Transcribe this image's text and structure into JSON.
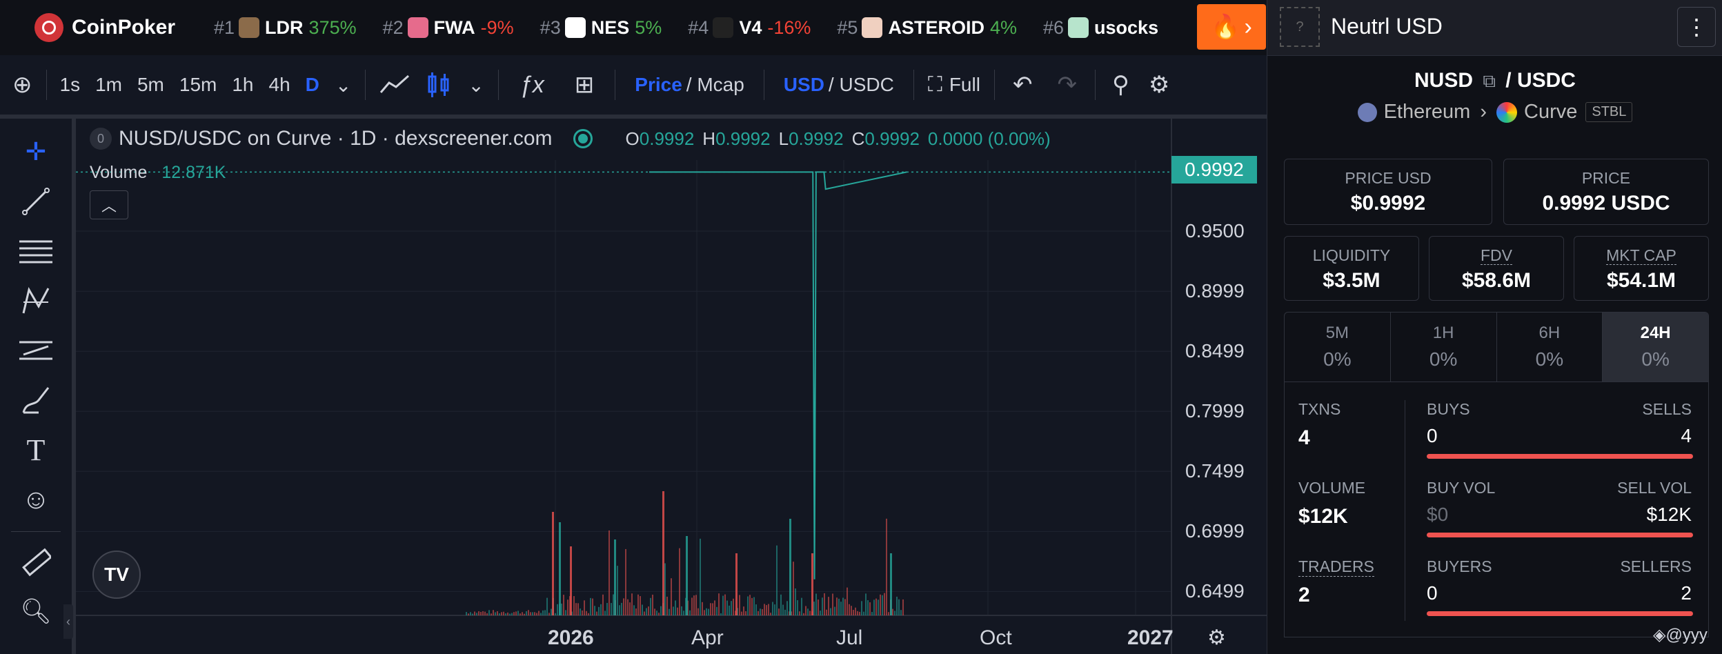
{
  "brand": {
    "name": "CoinPoker"
  },
  "tickers": [
    {
      "rank": "#1",
      "symbol": "LDR",
      "change": "375%",
      "dir": "pos",
      "color": "#8b6b4a"
    },
    {
      "rank": "#2",
      "symbol": "FWA",
      "change": "-9%",
      "dir": "neg",
      "color": "#e66b8c"
    },
    {
      "rank": "#3",
      "symbol": "NES",
      "change": "5%",
      "dir": "pos",
      "color": "#ffffff"
    },
    {
      "rank": "#4",
      "symbol": "V4",
      "change": "-16%",
      "dir": "neg",
      "color": "#222222"
    },
    {
      "rank": "#5",
      "symbol": "ASTEROID",
      "change": "4%",
      "dir": "pos",
      "color": "#f0d0c0"
    },
    {
      "rank": "#6",
      "symbol": "usocks",
      "change": "",
      "dir": "pos",
      "color": "#b7e4cc"
    }
  ],
  "toolbar": {
    "intervals": [
      "1s",
      "1m",
      "5m",
      "15m",
      "1h",
      "4h",
      "D"
    ],
    "price_label": "Price",
    "mcap_label": "/ Mcap",
    "usd_label": "USD",
    "usdc_label": "/ USDC",
    "full_label": "Full"
  },
  "chart_header": {
    "badge": "0",
    "title": "NUSD/USDC on Curve · 1D · dexscreener.com",
    "o_key": "O",
    "o_val": "0.9992",
    "h_key": "H",
    "h_val": "0.9992",
    "l_key": "L",
    "l_val": "0.9992",
    "c_key": "C",
    "c_val": "0.9992",
    "change": "0.0000 (0.00%)",
    "volume_label": "Volume",
    "volume_value": "12.871K"
  },
  "chart_data": {
    "type": "line",
    "pair": "NUSD/USDC",
    "last_price": "0.9992",
    "y_ticks": [
      "0.9500",
      "0.8999",
      "0.8499",
      "0.7999",
      "0.7499",
      "0.6999",
      "0.6499"
    ],
    "x_ticks": [
      "2026",
      "Apr",
      "Jul",
      "Oct",
      "2027"
    ],
    "ylim": [
      0.63,
      1.0
    ],
    "x": [
      "2026-03-01",
      "2026-06-12",
      "2026-06-13",
      "2026-06-14",
      "2026-06-19",
      "2026-06-20",
      "2026-08-10"
    ],
    "values": [
      0.9992,
      0.9992,
      0.66,
      0.9992,
      0.9992,
      0.985,
      0.9992
    ],
    "grid": true
  },
  "panel": {
    "token_placeholder": "?",
    "title": "Neutrl USD",
    "base": "NUSD",
    "quote": "/ USDC",
    "chain": "Ethereum",
    "dex": "Curve",
    "dex_tag": "STBL",
    "price_usd_label": "PRICE USD",
    "price_usd": "$0.9992",
    "price_label": "PRICE",
    "price": "0.9992 USDC",
    "liquidity_label": "LIQUIDITY",
    "liquidity": "$3.5M",
    "fdv_label": "FDV",
    "fdv": "$58.6M",
    "mcap_label": "MKT CAP",
    "mcap": "$54.1M",
    "timeframes": [
      {
        "label": "5M",
        "value": "0%"
      },
      {
        "label": "1H",
        "value": "0%"
      },
      {
        "label": "6H",
        "value": "0%"
      },
      {
        "label": "24H",
        "value": "0%"
      }
    ],
    "txns_label": "TXNS",
    "txns": "4",
    "buys_label": "BUYS",
    "buys": "0",
    "sells_label": "SELLS",
    "sells": "4",
    "volume_label": "VOLUME",
    "volume": "$12K",
    "buy_vol_label": "BUY VOL",
    "buy_vol": "$0",
    "sell_vol_label": "SELL VOL",
    "sell_vol": "$12K",
    "traders_label": "TRADERS",
    "traders": "2",
    "buyers_label": "BUYERS",
    "buyers": "0",
    "sellers_label": "SELLERS",
    "sellers": "2"
  },
  "footer": {
    "mark": "@yyy"
  },
  "colors": {
    "up": "#26a69a",
    "down": "#ef5350",
    "accent": "#2962ff",
    "fire": "#ff6b1a"
  }
}
